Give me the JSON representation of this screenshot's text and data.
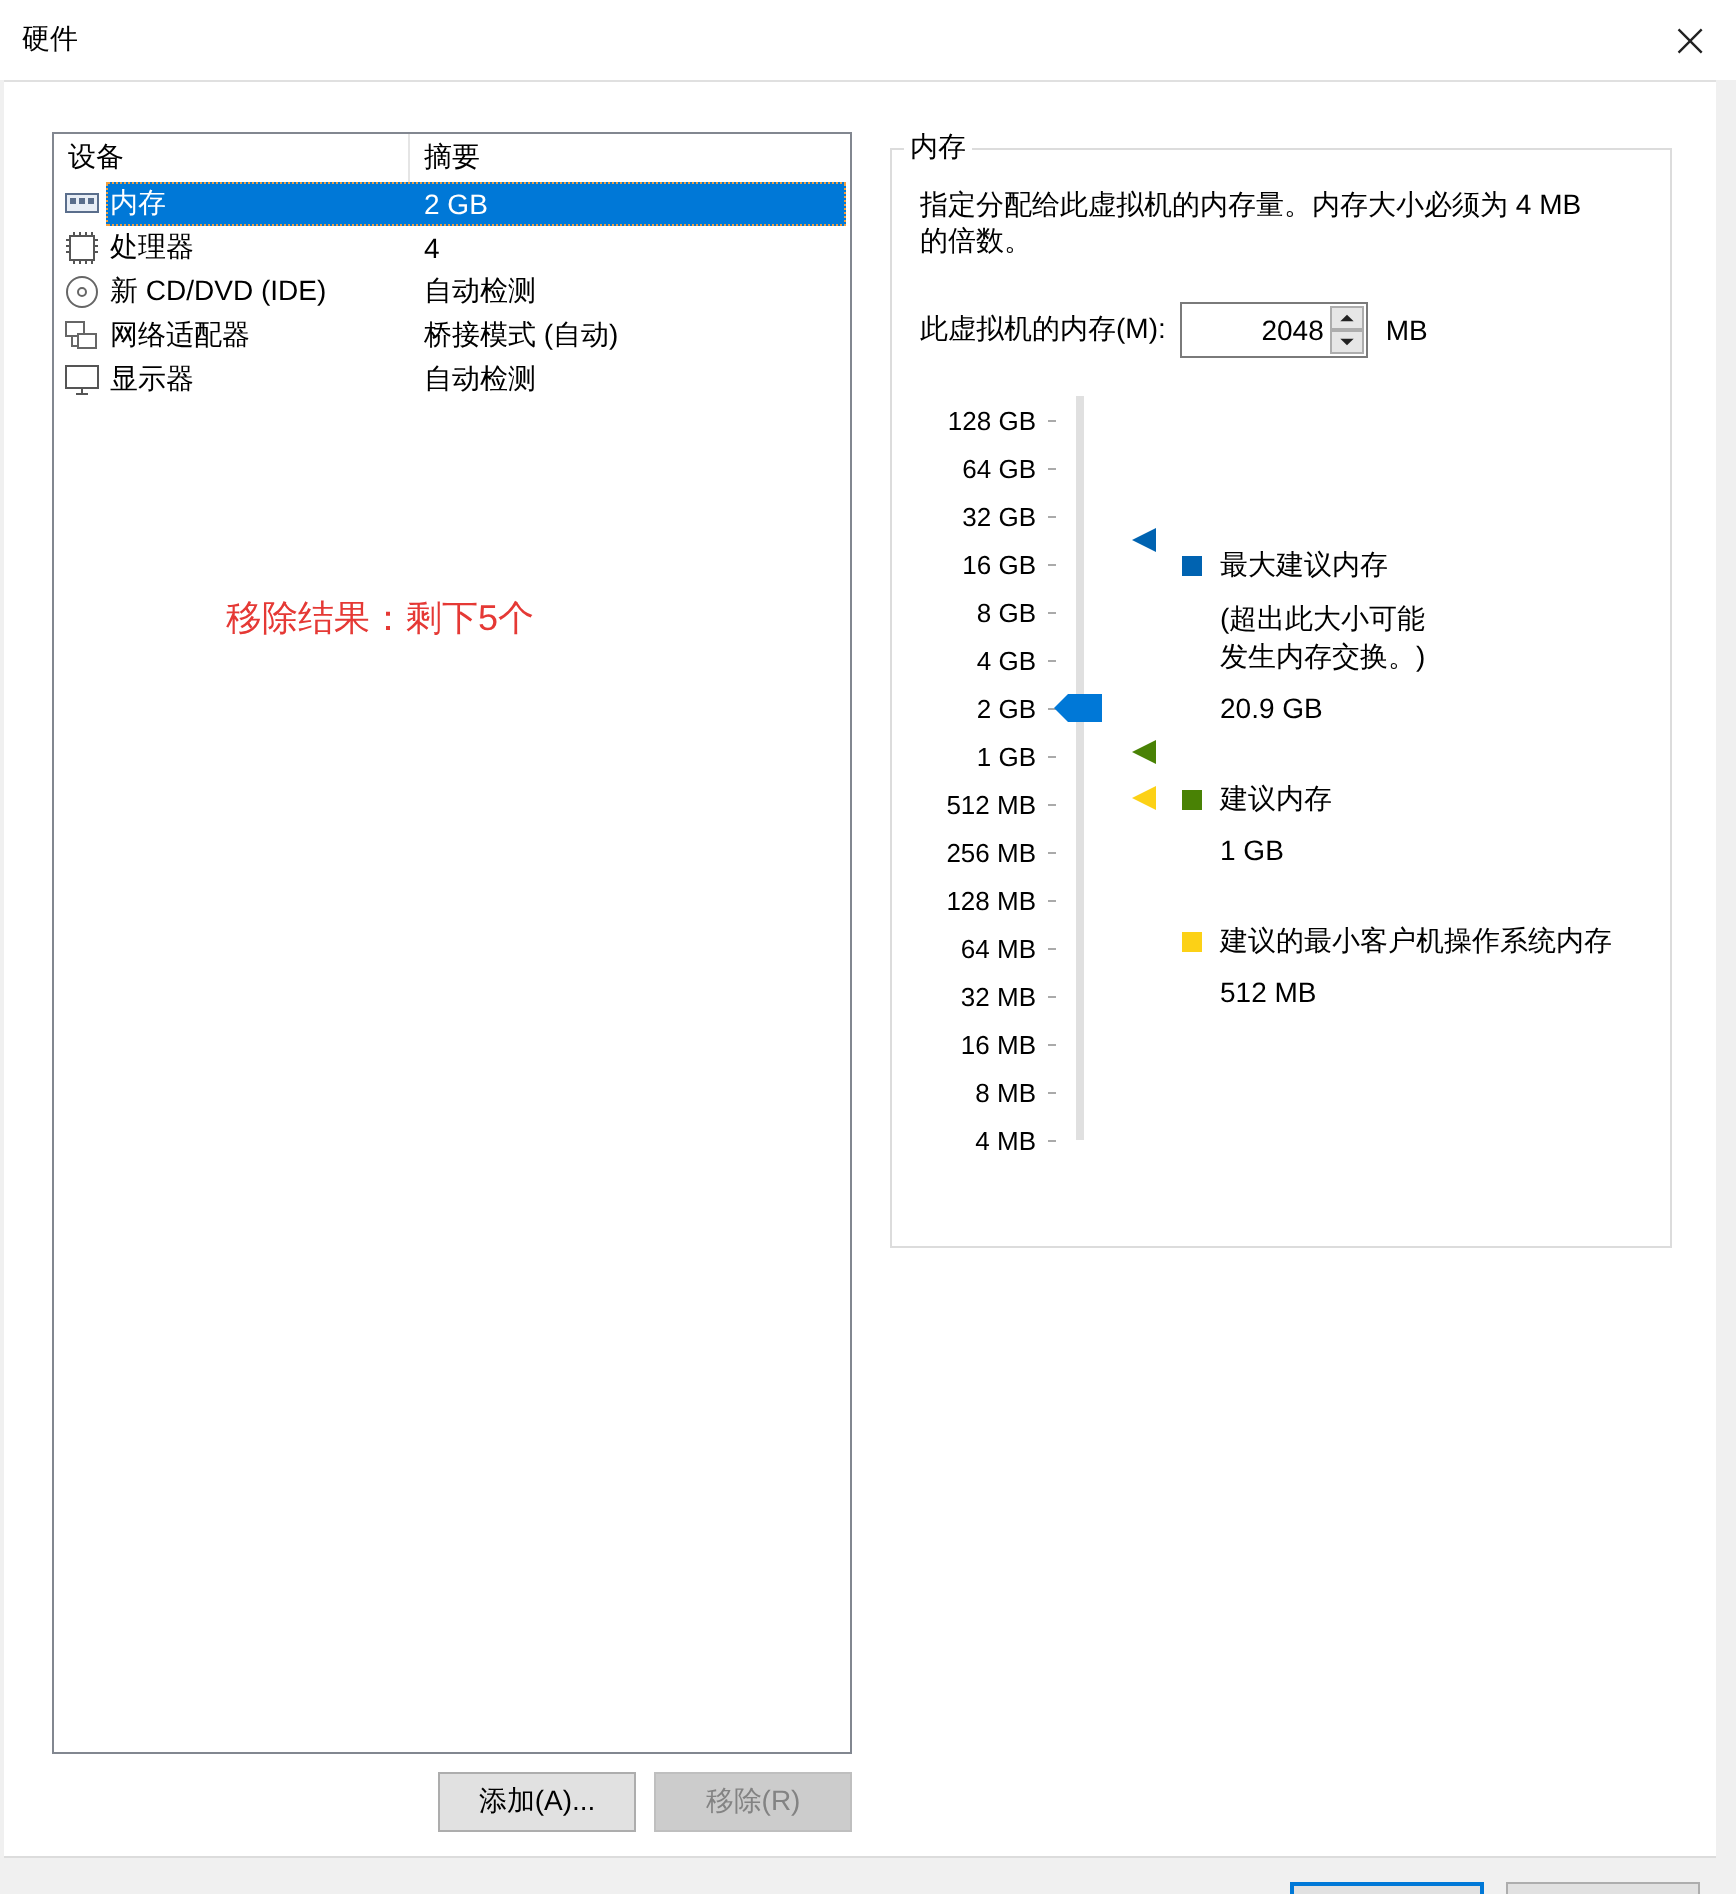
{
  "window": {
    "title": "硬件",
    "close": "×"
  },
  "devices": {
    "columns": [
      "设备",
      "摘要"
    ],
    "rows": [
      {
        "kind": "memory",
        "name": "内存",
        "summary": "2 GB",
        "selected": true
      },
      {
        "kind": "cpu",
        "name": "处理器",
        "summary": "4",
        "selected": false
      },
      {
        "kind": "cd",
        "name": "新 CD/DVD (IDE)",
        "summary": "自动检测",
        "selected": false
      },
      {
        "kind": "network",
        "name": "网络适配器",
        "summary": "桥接模式 (自动)",
        "selected": false
      },
      {
        "kind": "display",
        "name": "显示器",
        "summary": "自动检测",
        "selected": false
      }
    ],
    "buttons": [
      {
        "label": "添加(A)...",
        "disabled": false
      },
      {
        "label": "移除(R)",
        "disabled": true
      }
    ]
  },
  "annotation": "移除结果：剩下5个",
  "memory": {
    "title": "内存",
    "description": "指定分配给此虚拟机的内存量。内存大小必须为 4 MB 的倍数。",
    "field_label": "此虚拟机的内存(M):",
    "value": "2048",
    "unit": "MB",
    "slider": {
      "level": 0.6,
      "labels": [
        "128 GB",
        "64 GB",
        "32 GB",
        "16 GB",
        "8 GB",
        "4 GB",
        "2 GB",
        "1 GB",
        "512 MB",
        "256 MB",
        "128 MB",
        "64 MB",
        "32 MB",
        "16 MB",
        "8 MB",
        "4 MB"
      ]
    },
    "legend": [
      {
        "color": "#0063b1",
        "title": "最大建议内存",
        "note": "(超出此大小可能发生内存交换。)",
        "value": "20.9 GB"
      },
      {
        "color": "#498205",
        "title": "建议内存",
        "value": "1 GB"
      },
      {
        "color": "#fcd116",
        "title": "建议的最小客户机操作系统内存",
        "value": "512 MB"
      }
    ]
  }
}
